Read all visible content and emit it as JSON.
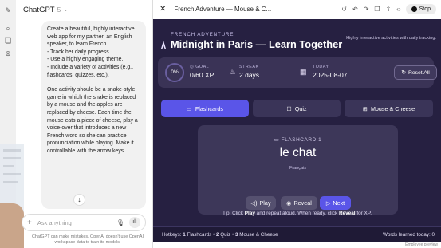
{
  "rail": {
    "icons": [
      "new-chat-icon",
      "search-icon",
      "library-icon"
    ]
  },
  "chat": {
    "app_name": "ChatGPT",
    "version": "5",
    "message": "Create a beautiful, highly interactive web app for my partner, an English speaker, to learn French.\n- Track her daily progress.\n- Use a highly engaging theme.\n- Include a variety of activities (e.g., flashcards, quizzes, etc.).",
    "message2": "One activity should be a snake-style game in which the snake is replaced by a mouse and the apples are replaced by cheese. Each time the mouse eats a piece of cheese, play a voice-over that introduces a new French word so she can practice pronunciation while playing. Make it controllable with the arrow keys.",
    "composer_placeholder": "Ask anything",
    "disclaimer": "ChatGPT can make mistakes. OpenAI doesn't use OpenAI workspace data to train its models."
  },
  "canvas": {
    "title": "French Adventure — Mouse & C...",
    "stop_label": "Stop",
    "employee_preview": "Employee preview"
  },
  "app": {
    "kicker": "FRENCH ADVENTURE",
    "title": "Midnight in Paris — Learn Together",
    "tagline": "Highly interactive activities with daily tracking.",
    "stats": {
      "ring": "0%",
      "goal_label": "GOAL",
      "goal_value": "0/60 XP",
      "streak_label": "STREAK",
      "streak_value": "2 days",
      "today_label": "TODAY",
      "today_value": "2025-08-07",
      "reset_label": "Reset All"
    },
    "tabs": [
      "Flashcards",
      "Quiz",
      "Mouse & Cheese"
    ],
    "card": {
      "label": "FLASHCARD 1",
      "word": "le chat",
      "language": "Français",
      "play": "Play",
      "reveal": "Reveal",
      "next": "Next"
    },
    "tip": {
      "pre": "Tip: Click ",
      "play": "Play",
      "mid": " and repeat aloud. When ready, click ",
      "reveal": "Reveal",
      "post": " for XP."
    },
    "footer": {
      "hotkeys_prefix": "Hotkeys: ",
      "hk1": "1",
      "hk1_text": " Flashcards • ",
      "hk2": "2",
      "hk2_text": " Quiz • ",
      "hk3": "3",
      "hk3_text": " Mouse & Cheese",
      "words_learned": "Words learned today: 0"
    },
    "colors": {
      "background": "#262041",
      "accent": "#5a55e8",
      "card": "#3d3759"
    }
  }
}
